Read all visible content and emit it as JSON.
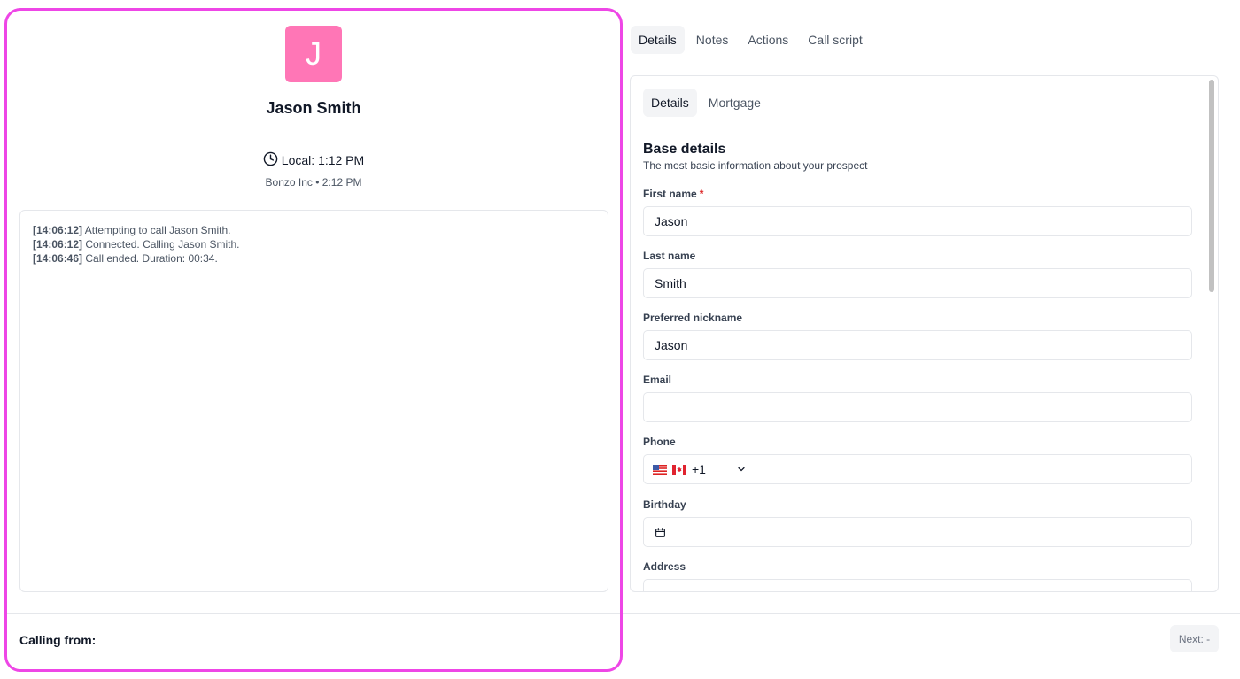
{
  "contact": {
    "initial": "J",
    "name": "Jason Smith",
    "local_time": "Local: 1:12 PM",
    "company_line": "Bonzo Inc • 2:12 PM",
    "avatar_color": "#ff76b6"
  },
  "call_log": [
    {
      "time": "[14:06:12]",
      "message": "Attempting to call Jason Smith."
    },
    {
      "time": "[14:06:12]",
      "message": "Connected. Calling Jason Smith."
    },
    {
      "time": "[14:06:46]",
      "message": "Call ended. Duration: 00:34."
    }
  ],
  "footer": {
    "calling_from": "Calling from:",
    "next_label": "Next: -"
  },
  "main_tabs": [
    "Details",
    "Notes",
    "Actions",
    "Call script"
  ],
  "sub_tabs": [
    "Details",
    "Mortgage"
  ],
  "form": {
    "section_title": "Base details",
    "section_subtitle": "The most basic information about your prospect",
    "first_name": {
      "label": "First name",
      "required": "*",
      "value": "Jason"
    },
    "last_name": {
      "label": "Last name",
      "value": "Smith"
    },
    "nickname": {
      "label": "Preferred nickname",
      "value": "Jason"
    },
    "email": {
      "label": "Email",
      "value": ""
    },
    "phone": {
      "label": "Phone",
      "country_code": "+1",
      "value": ""
    },
    "birthday": {
      "label": "Birthday",
      "value": ""
    },
    "address": {
      "label": "Address",
      "value": ""
    }
  },
  "colors": {
    "highlight_border": "#ee46e6",
    "active_tab_bg": "#f3f4f6",
    "required": "#dc2626"
  }
}
